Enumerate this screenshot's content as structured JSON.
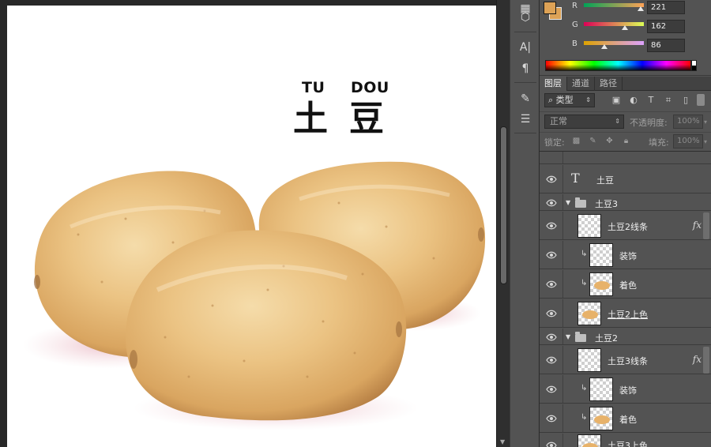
{
  "document": {
    "pinyin_left": "TU",
    "pinyin_right": "DOU",
    "title_left": "土",
    "title_right": "豆"
  },
  "color_panel": {
    "foreground_hex": "#dda256",
    "channels": [
      {
        "label": "R",
        "value": "221"
      },
      {
        "label": "G",
        "value": "162"
      },
      {
        "label": "B",
        "value": "86"
      }
    ]
  },
  "tabs": [
    {
      "label": "图层"
    },
    {
      "label": "通道"
    },
    {
      "label": "路径"
    }
  ],
  "layers_panel": {
    "kind_filter": "类型",
    "blend_mode": "正常",
    "opacity_label": "不透明度:",
    "opacity_value": "100%",
    "lock_label": "锁定:",
    "fill_label": "填充:",
    "fill_value": "100%"
  },
  "layers": [
    {
      "name": "土豆",
      "type": "text"
    },
    {
      "name": "土豆3",
      "type": "group"
    },
    {
      "name": "土豆2线条",
      "type": "layer",
      "fx": "fx"
    },
    {
      "name": "装饰",
      "type": "clipped"
    },
    {
      "name": "着色",
      "type": "clipped"
    },
    {
      "name": "土豆2上色",
      "type": "layer"
    },
    {
      "name": "土豆2",
      "type": "group"
    },
    {
      "name": "土豆3线条",
      "type": "layer",
      "fx": "fx"
    },
    {
      "name": "装饰",
      "type": "clipped"
    },
    {
      "name": "着色",
      "type": "clipped"
    },
    {
      "name": "土豆3上色",
      "type": "layer"
    }
  ]
}
